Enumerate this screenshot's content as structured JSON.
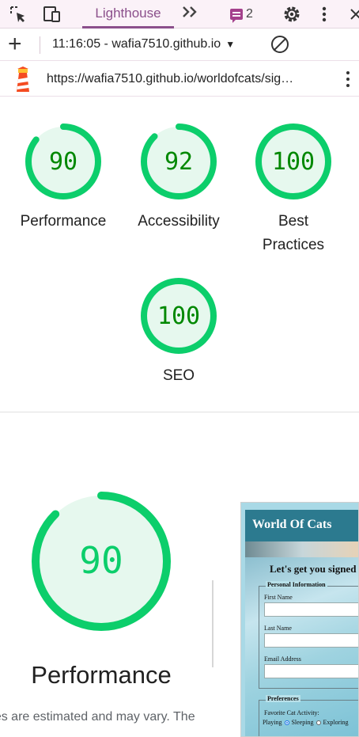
{
  "devtools": {
    "active_tab": "Lighthouse",
    "message_count": "2"
  },
  "toolbar": {
    "report_selector": "11:16:05 - wafia7510.github.io"
  },
  "urlbar": {
    "url": "https://wafia7510.github.io/worldofcats/sig…"
  },
  "colors": {
    "pass": "#0cce6b",
    "pass_fill": "#e6f8ee",
    "pass_text": "#008800",
    "tab_accent": "#8b4f8b"
  },
  "gauges": [
    {
      "score": 90,
      "label": "Performance"
    },
    {
      "score": 92,
      "label": "Accessibility"
    },
    {
      "score": 100,
      "label": "Best Practices"
    },
    {
      "score": 100,
      "label": "SEO"
    }
  ],
  "performance": {
    "score": 90,
    "label": "Performance",
    "disclaimer": "Values are estimated and may vary. The"
  },
  "thumbnail": {
    "site_title": "World Of Cats",
    "heading": "Let's get you signed",
    "personal_legend": "Personal Information",
    "first_name": "First Name",
    "last_name": "Last Name",
    "email": "Email Address",
    "prefs_legend": "Preferences",
    "activity_label": "Favorite Cat Activity:",
    "options": [
      "Playing",
      "Sleeping",
      "Exploring"
    ]
  }
}
